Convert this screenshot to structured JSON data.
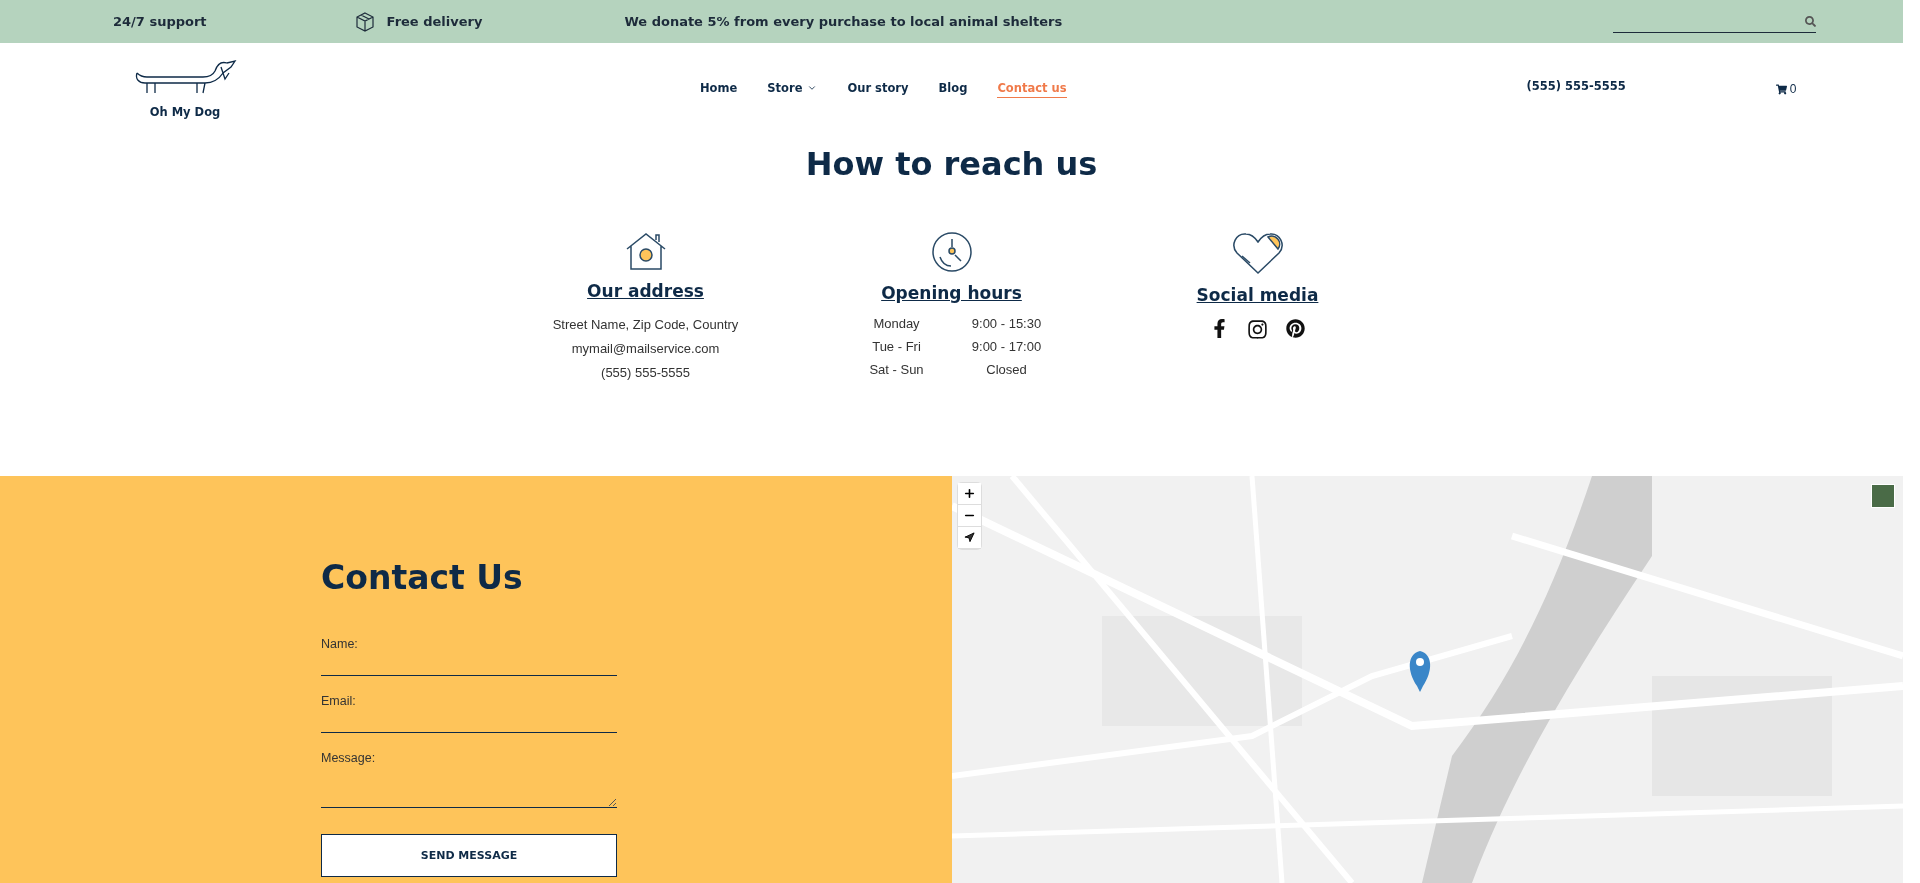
{
  "top_bar": {
    "items": [
      {
        "text": "24/7 support",
        "kind": "plain"
      },
      {
        "text": "Free delivery",
        "kind": "box"
      },
      {
        "text": "We donate 5% from every purchase to local animal shelters",
        "kind": "plain"
      }
    ]
  },
  "header": {
    "logo": "Oh My Dog",
    "nav": [
      {
        "label": "Home",
        "selected": false,
        "has_menu": false
      },
      {
        "label": "Store",
        "selected": false,
        "has_menu": true
      },
      {
        "label": "Our story",
        "selected": false,
        "has_menu": false
      },
      {
        "label": "Blog",
        "selected": false,
        "has_menu": false
      },
      {
        "label": "Contact us",
        "selected": true,
        "has_menu": false
      }
    ],
    "phone": "(555) 555-5555",
    "cart_count": "0"
  },
  "reach": {
    "title": "How to reach us",
    "columns": [
      {
        "kind": "address",
        "heading": "Our address",
        "lines": [
          "Street Name, Zip Code, Country",
          "mymail@mailservice.com",
          "(555) 555-5555"
        ]
      },
      {
        "kind": "hours",
        "heading": "Opening hours",
        "rows": [
          {
            "day": "Monday",
            "time": "9:00 - 15:30"
          },
          {
            "day": "Tue - Fri",
            "time": "9:00 - 17:00"
          },
          {
            "day": "Sat - Sun",
            "time": "Closed"
          }
        ]
      },
      {
        "kind": "social",
        "heading": "Social media"
      }
    ]
  },
  "contact": {
    "title": "Contact Us",
    "fields": [
      {
        "label": "Name:",
        "kind": "line"
      },
      {
        "label": "Email:",
        "kind": "line"
      },
      {
        "label": "Message:",
        "kind": "area"
      }
    ],
    "button": "SEND MESSAGE"
  }
}
